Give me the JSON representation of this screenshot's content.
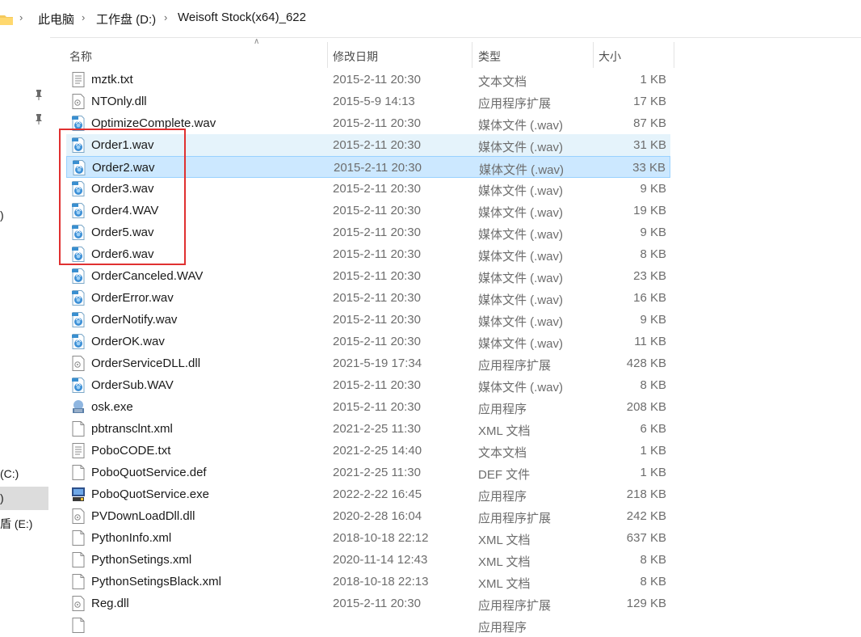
{
  "breadcrumb": {
    "items": [
      "此电脑",
      "工作盘 (D:)",
      "Weisoft Stock(x64)_622"
    ]
  },
  "nav": {
    "drive_c": "(C:)",
    "drive_d": ")",
    "drive_e": "盾 (E:)",
    "misc": ")"
  },
  "columns": {
    "name": "名称",
    "date": "修改日期",
    "type": "类型",
    "size": "大小"
  },
  "annotation_color": "#e03030",
  "files": [
    {
      "name": "mztk.txt",
      "date": "2015-2-11 20:30",
      "type": "文本文档",
      "size": "1 KB",
      "icon": "text-file-icon"
    },
    {
      "name": "NTOnly.dll",
      "date": "2015-5-9 14:13",
      "type": "应用程序扩展",
      "size": "17 KB",
      "icon": "dll-file-icon"
    },
    {
      "name": "OptimizeComplete.wav",
      "date": "2015-2-11 20:30",
      "type": "媒体文件 (.wav)",
      "size": "87 KB",
      "icon": "wav-file-icon"
    },
    {
      "name": "Order1.wav",
      "date": "2015-2-11 20:30",
      "type": "媒体文件 (.wav)",
      "size": "31 KB",
      "icon": "wav-file-icon"
    },
    {
      "name": "Order2.wav",
      "date": "2015-2-11 20:30",
      "type": "媒体文件 (.wav)",
      "size": "33 KB",
      "icon": "wav-file-icon"
    },
    {
      "name": "Order3.wav",
      "date": "2015-2-11 20:30",
      "type": "媒体文件 (.wav)",
      "size": "9 KB",
      "icon": "wav-file-icon"
    },
    {
      "name": "Order4.WAV",
      "date": "2015-2-11 20:30",
      "type": "媒体文件 (.wav)",
      "size": "19 KB",
      "icon": "wav-file-icon"
    },
    {
      "name": "Order5.wav",
      "date": "2015-2-11 20:30",
      "type": "媒体文件 (.wav)",
      "size": "9 KB",
      "icon": "wav-file-icon"
    },
    {
      "name": "Order6.wav",
      "date": "2015-2-11 20:30",
      "type": "媒体文件 (.wav)",
      "size": "8 KB",
      "icon": "wav-file-icon"
    },
    {
      "name": "OrderCanceled.WAV",
      "date": "2015-2-11 20:30",
      "type": "媒体文件 (.wav)",
      "size": "23 KB",
      "icon": "wav-file-icon"
    },
    {
      "name": "OrderError.wav",
      "date": "2015-2-11 20:30",
      "type": "媒体文件 (.wav)",
      "size": "16 KB",
      "icon": "wav-file-icon"
    },
    {
      "name": "OrderNotify.wav",
      "date": "2015-2-11 20:30",
      "type": "媒体文件 (.wav)",
      "size": "9 KB",
      "icon": "wav-file-icon"
    },
    {
      "name": "OrderOK.wav",
      "date": "2015-2-11 20:30",
      "type": "媒体文件 (.wav)",
      "size": "11 KB",
      "icon": "wav-file-icon"
    },
    {
      "name": "OrderServiceDLL.dll",
      "date": "2021-5-19 17:34",
      "type": "应用程序扩展",
      "size": "428 KB",
      "icon": "dll-file-icon"
    },
    {
      "name": "OrderSub.WAV",
      "date": "2015-2-11 20:30",
      "type": "媒体文件 (.wav)",
      "size": "8 KB",
      "icon": "wav-file-icon"
    },
    {
      "name": "osk.exe",
      "date": "2015-2-11 20:30",
      "type": "应用程序",
      "size": "208 KB",
      "icon": "keyboard-app-icon"
    },
    {
      "name": "pbtransclnt.xml",
      "date": "2021-2-25 11:30",
      "type": "XML 文档",
      "size": "6 KB",
      "icon": "blank-file-icon"
    },
    {
      "name": "PoboCODE.txt",
      "date": "2021-2-25 14:40",
      "type": "文本文档",
      "size": "1 KB",
      "icon": "text-file-icon"
    },
    {
      "name": "PoboQuotService.def",
      "date": "2021-2-25 11:30",
      "type": "DEF 文件",
      "size": "1 KB",
      "icon": "blank-file-icon"
    },
    {
      "name": "PoboQuotService.exe",
      "date": "2022-2-22 16:45",
      "type": "应用程序",
      "size": "218 KB",
      "icon": "service-app-icon"
    },
    {
      "name": "PVDownLoadDll.dll",
      "date": "2020-2-28 16:04",
      "type": "应用程序扩展",
      "size": "242 KB",
      "icon": "dll-file-icon"
    },
    {
      "name": "PythonInfo.xml",
      "date": "2018-10-18 22:12",
      "type": "XML 文档",
      "size": "637 KB",
      "icon": "blank-file-icon"
    },
    {
      "name": "PythonSetings.xml",
      "date": "2020-11-14 12:43",
      "type": "XML 文档",
      "size": "8 KB",
      "icon": "blank-file-icon"
    },
    {
      "name": "PythonSetingsBlack.xml",
      "date": "2018-10-18 22:13",
      "type": "XML 文档",
      "size": "8 KB",
      "icon": "blank-file-icon"
    },
    {
      "name": "Reg.dll",
      "date": "2015-2-11 20:30",
      "type": "应用程序扩展",
      "size": "129 KB",
      "icon": "dll-file-icon"
    },
    {
      "name": "",
      "date": "",
      "type": "应用程序",
      "size": "",
      "icon": "blank-file-icon"
    }
  ]
}
